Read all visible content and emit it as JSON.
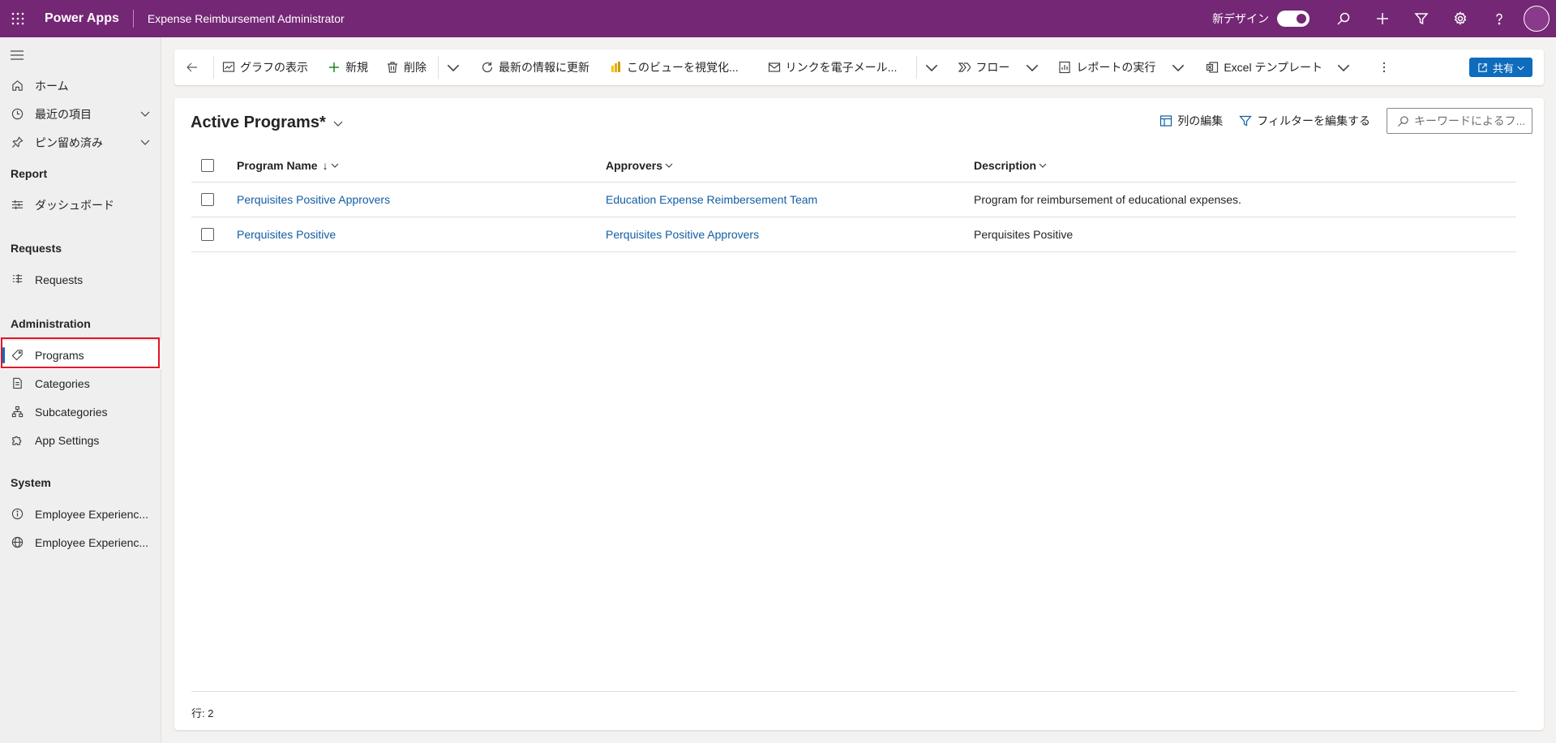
{
  "topbar": {
    "brand": "Power Apps",
    "app_title": "Expense Reimbursement Administrator",
    "new_design_label": "新デザイン",
    "bg_color": "#742774"
  },
  "sidebar": {
    "home": "ホーム",
    "recent": "最近の項目",
    "pinned": "ピン留め済み",
    "sections": [
      {
        "title": "Report",
        "items": [
          {
            "label": "ダッシュボード",
            "icon": "dashboard-icon"
          }
        ]
      },
      {
        "title": "Requests",
        "items": [
          {
            "label": "Requests",
            "icon": "list-icon"
          }
        ]
      },
      {
        "title": "Administration",
        "items": [
          {
            "label": "Programs",
            "icon": "tag-icon",
            "selected": true
          },
          {
            "label": "Categories",
            "icon": "document-icon"
          },
          {
            "label": "Subcategories",
            "icon": "hierarchy-icon"
          },
          {
            "label": "App Settings",
            "icon": "puzzle-icon"
          }
        ]
      },
      {
        "title": "System",
        "items": [
          {
            "label": "Employee Experienc...",
            "icon": "info-icon"
          },
          {
            "label": "Employee Experienc...",
            "icon": "globe-icon"
          }
        ]
      }
    ]
  },
  "commandbar": {
    "show_chart": "グラフの表示",
    "new": "新規",
    "delete": "削除",
    "refresh": "最新の情報に更新",
    "visualize": "このビューを視覚化...",
    "email_link": "リンクを電子メール...",
    "flow": "フロー",
    "run_report": "レポートの実行",
    "excel_template": "Excel テンプレート",
    "share": "共有"
  },
  "view": {
    "title": "Active Programs*",
    "edit_columns": "列の編集",
    "edit_filters": "フィルターを編集する",
    "search_placeholder": "キーワードによるフ..."
  },
  "grid": {
    "columns": [
      "Program Name",
      "Approvers",
      "Description"
    ],
    "sort_indicator": "↓",
    "rows": [
      {
        "name": "Perquisites Positive Approvers",
        "approvers": "Education Expense Reimbersement Team",
        "description": "Program for reimbursement of educational expenses."
      },
      {
        "name": "Perquisites Positive",
        "approvers": "Perquisites Positive Approvers",
        "description": "Perquisites Positive"
      }
    ],
    "row_count": "行: 2"
  }
}
